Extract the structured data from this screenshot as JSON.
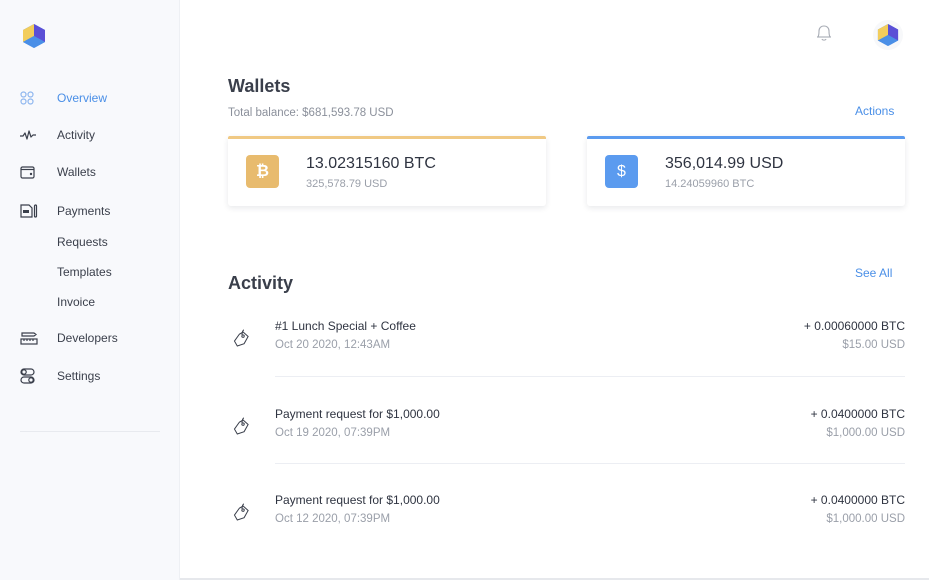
{
  "brand": {
    "logo": "hexagon-cube-logo",
    "colors": {
      "yellow": "#f2cd5c",
      "purple": "#5b4fd6",
      "blue": "#4a8fe7"
    }
  },
  "topbar": {
    "notifications_icon": "bell-icon",
    "avatar_icon": "hexagon-cube-avatar"
  },
  "sidebar": {
    "items": [
      {
        "label": "Overview",
        "icon": "grid-circles-icon",
        "active": true
      },
      {
        "label": "Activity",
        "icon": "pulse-icon",
        "active": false
      },
      {
        "label": "Wallets",
        "icon": "wallet-icon",
        "active": false
      },
      {
        "label": "Payments",
        "icon": "payments-icon",
        "active": false
      },
      {
        "label": "Developers",
        "icon": "developer-tools-icon",
        "active": false
      },
      {
        "label": "Settings",
        "icon": "settings-toggles-icon",
        "active": false
      }
    ],
    "payments_sub": [
      {
        "label": "Requests"
      },
      {
        "label": "Templates"
      },
      {
        "label": "Invoice"
      }
    ]
  },
  "wallets": {
    "title": "Wallets",
    "total_balance": "Total balance: $681,593.78 USD",
    "actions_label": "Actions",
    "cards": [
      {
        "symbol": "₿",
        "icon": "bitcoin-icon",
        "primary": "13.02315160 BTC",
        "secondary": "325,578.79 USD",
        "accent": "#f0c984",
        "badge_color": "#e8bb6e"
      },
      {
        "symbol": "$",
        "icon": "dollar-icon",
        "primary": "356,014.99 USD",
        "secondary": "14.24059960 BTC",
        "accent": "#5b9bef",
        "badge_color": "#5b9bef"
      }
    ]
  },
  "activity": {
    "title": "Activity",
    "see_all_label": "See All",
    "items": [
      {
        "title": "#1 Lunch Special + Coffee",
        "date": "Oct 20 2020, 12:43AM",
        "amount": "+ 0.00060000 BTC",
        "fiat": "$15.00 USD"
      },
      {
        "title": "Payment request for $1,000.00",
        "date": "Oct 19 2020, 07:39PM",
        "amount": "+ 0.0400000 BTC",
        "fiat": "$1,000.00 USD"
      },
      {
        "title": "Payment request for $1,000.00",
        "date": "Oct 12 2020, 07:39PM",
        "amount": "+ 0.0400000 BTC",
        "fiat": "$1,000.00 USD"
      }
    ]
  }
}
